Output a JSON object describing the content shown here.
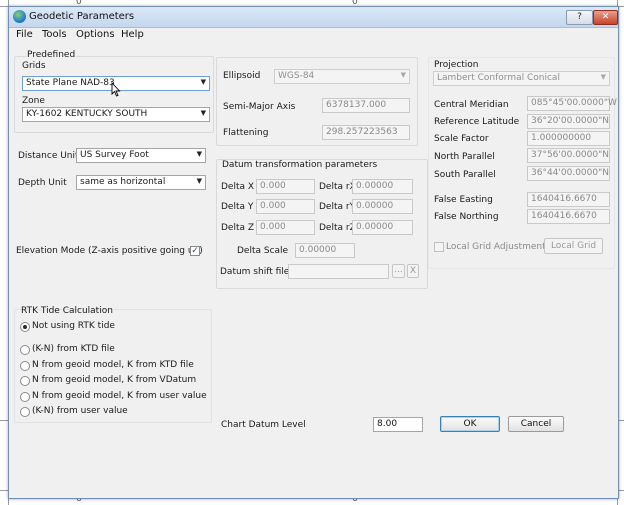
{
  "window": {
    "title": "Geodetic Parameters",
    "help_glyph": "?",
    "close_glyph": "✕"
  },
  "menu": [
    "File",
    "Tools",
    "Options",
    "Help"
  ],
  "predefined": {
    "section_label": "Predefined",
    "grids_label": "Grids",
    "grids_value": "State Plane NAD-83",
    "zone_label": "Zone",
    "zone_value": "KY-1602 KENTUCKY SOUTH"
  },
  "units": {
    "distance_label": "Distance Unit",
    "distance_value": "US Survey Foot",
    "depth_label": "Depth Unit",
    "depth_value": "same as horizontal"
  },
  "elevation": {
    "label": "Elevation Mode (Z-axis positive going up)",
    "checked": true
  },
  "ellipsoid": {
    "label": "Ellipsoid",
    "value": "WGS-84",
    "semi_major_label": "Semi-Major Axis",
    "semi_major_value": "6378137.000",
    "flattening_label": "Flattening",
    "flattening_value": "298.257223563"
  },
  "datum": {
    "section_label": "Datum transformation parameters",
    "delta_x_label": "Delta X",
    "delta_x_value": "0.000",
    "delta_y_label": "Delta Y",
    "delta_y_value": "0.000",
    "delta_z_label": "Delta Z",
    "delta_z_value": "0.000",
    "delta_rx_label": "Delta rX",
    "delta_rx_value": "0.00000",
    "delta_ry_label": "Delta rY",
    "delta_ry_value": "0.00000",
    "delta_rz_label": "Delta rZ",
    "delta_rz_value": "0.00000",
    "delta_scale_label": "Delta Scale",
    "delta_scale_value": "0.00000",
    "shift_file_label": "Datum shift file",
    "shift_file_value": "",
    "browse_label": "...",
    "clear_label": "X"
  },
  "projection": {
    "section_label": "Projection",
    "value": "Lambert Conformal Conical",
    "central_meridian_label": "Central Meridian",
    "central_meridian_value": "085°45'00.0000\"W",
    "ref_lat_label": "Reference Latitude",
    "ref_lat_value": "36°20'00.0000\"N",
    "scale_factor_label": "Scale Factor",
    "scale_factor_value": "1.000000000",
    "north_parallel_label": "North Parallel",
    "north_parallel_value": "37°56'00.0000\"N",
    "south_parallel_label": "South Parallel",
    "south_parallel_value": "36°44'00.0000\"N",
    "false_easting_label": "False Easting",
    "false_easting_value": "1640416.6670",
    "false_northing_label": "False Northing",
    "false_northing_value": "1640416.6670",
    "local_grid_adj_label": "Local Grid Adjustment",
    "local_grid_button": "Local Grid"
  },
  "rtk": {
    "section_label": "RTK Tide Calculation",
    "options": [
      "Not using RTK tide",
      "(K-N) from KTD file",
      "N from geoid model, K from KTD file",
      "N from geoid model, K from VDatum",
      "N from geoid model, K from user value",
      "(K-N) from user value"
    ],
    "selected_index": 0
  },
  "chart_datum": {
    "label": "Chart Datum Level",
    "value": "8.00"
  },
  "buttons": {
    "ok": "OK",
    "cancel": "Cancel"
  },
  "background": {
    "glyph_top": "0",
    "glyph_bottom": "6"
  }
}
